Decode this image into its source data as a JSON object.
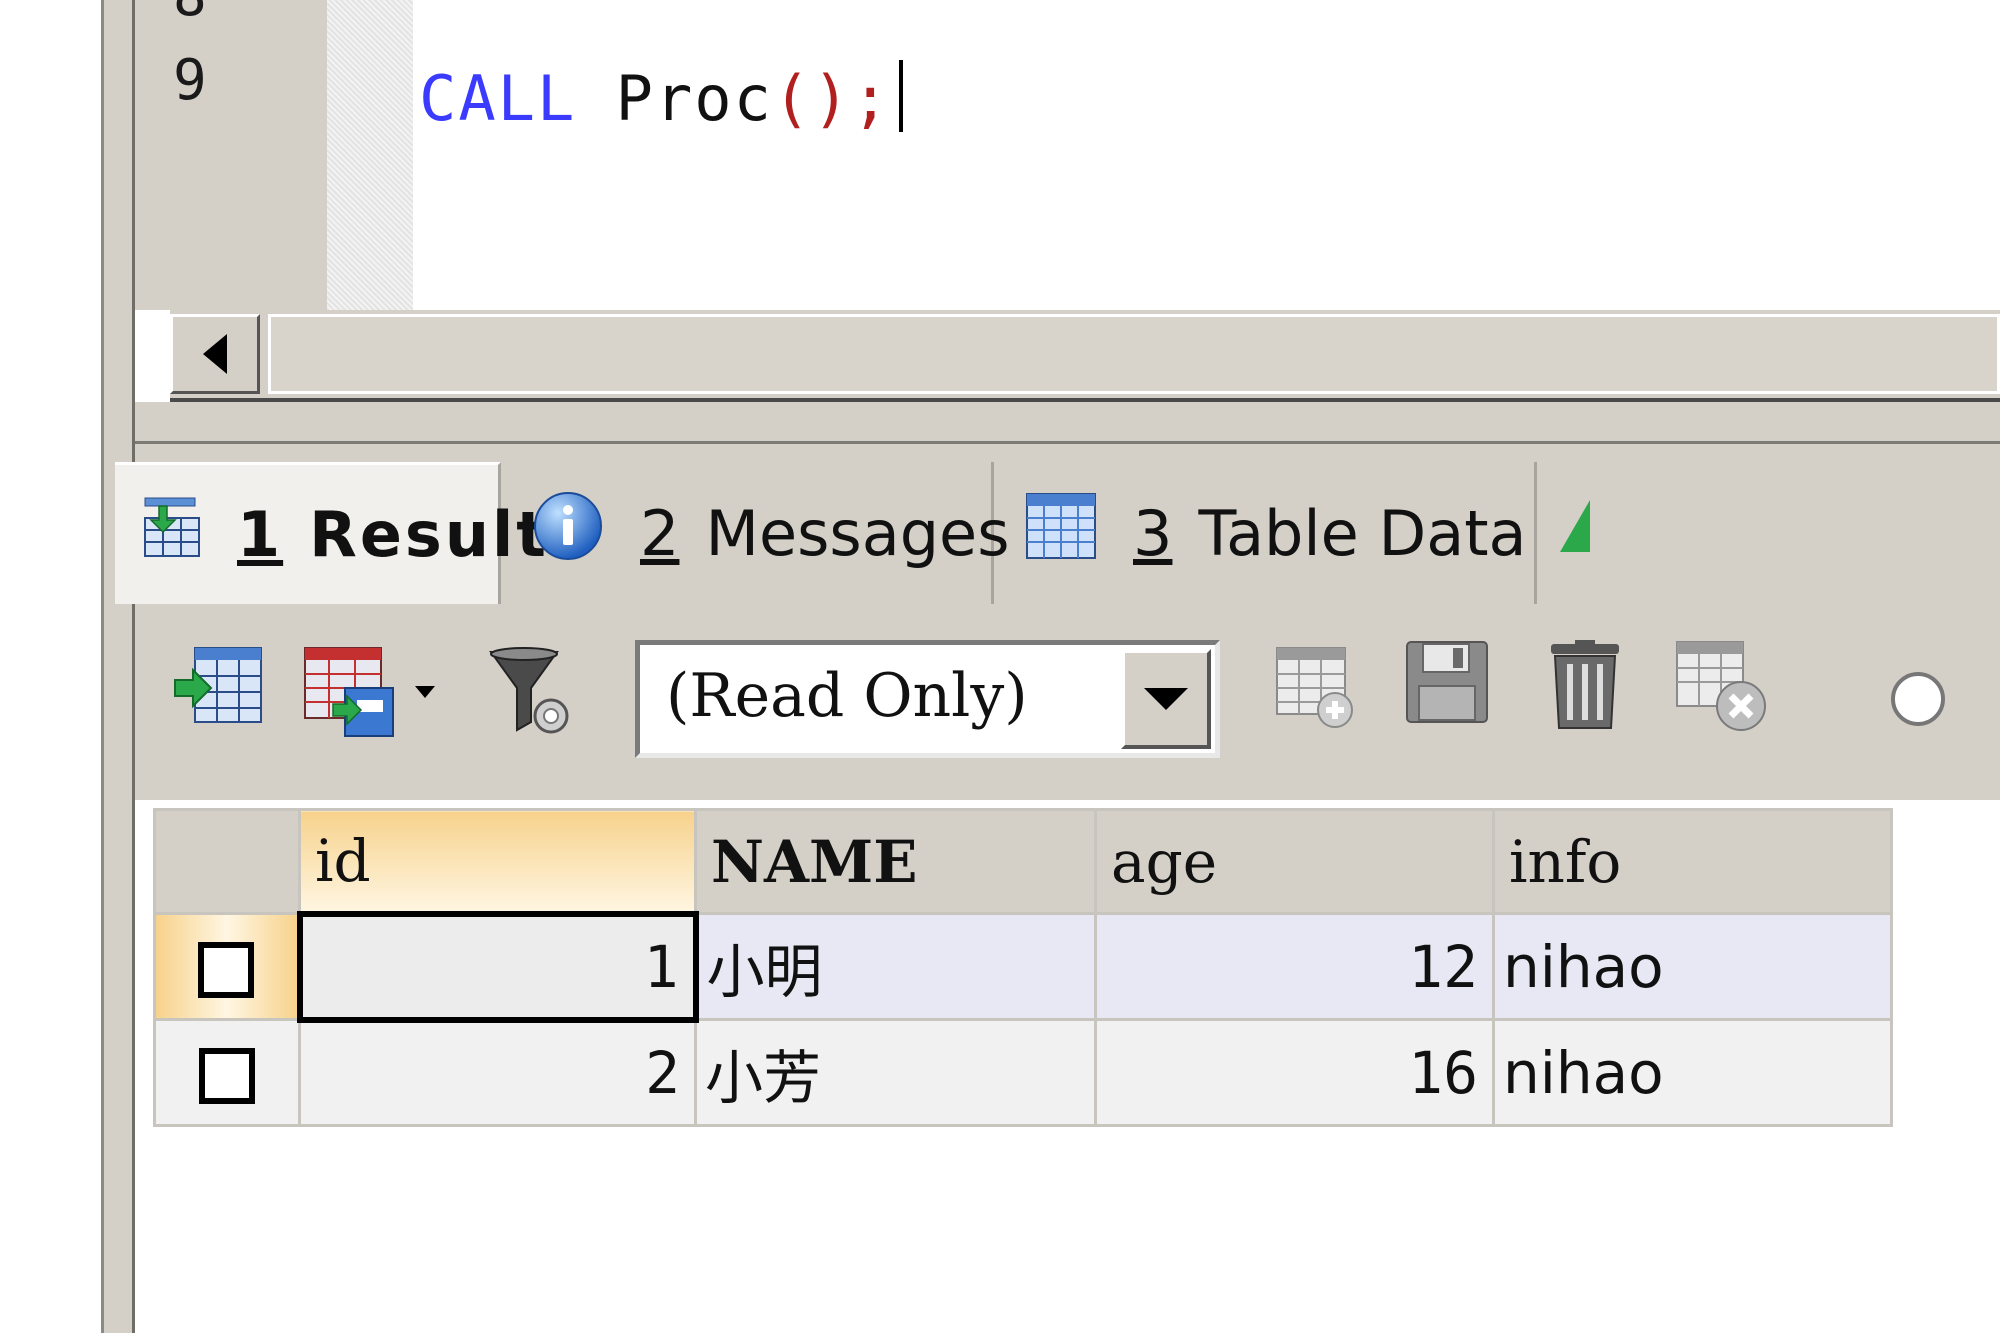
{
  "editor": {
    "line_numbers": [
      "8",
      "9"
    ],
    "code": {
      "keyword": "CALL",
      "name": "Proc",
      "parens": "()",
      "terminator": ";"
    }
  },
  "tabs": [
    {
      "number": "1",
      "label": "Result"
    },
    {
      "number": "2",
      "label": "Messages"
    },
    {
      "number": "3",
      "label": "Table Data"
    }
  ],
  "toolbar": {
    "mode_value": "(Read Only)"
  },
  "grid": {
    "columns": [
      "id",
      "NAME",
      "age",
      "info"
    ],
    "rows": [
      {
        "id": "1",
        "name": "小明",
        "age": "12",
        "info": "nihao"
      },
      {
        "id": "2",
        "name": "小芳",
        "age": "16",
        "info": "nihao"
      }
    ]
  },
  "colors": {
    "keyword": "#3b3bff",
    "paren": "#b11f1f",
    "chrome": "#d4d0c8",
    "sorted_header": "#f7d28c"
  }
}
